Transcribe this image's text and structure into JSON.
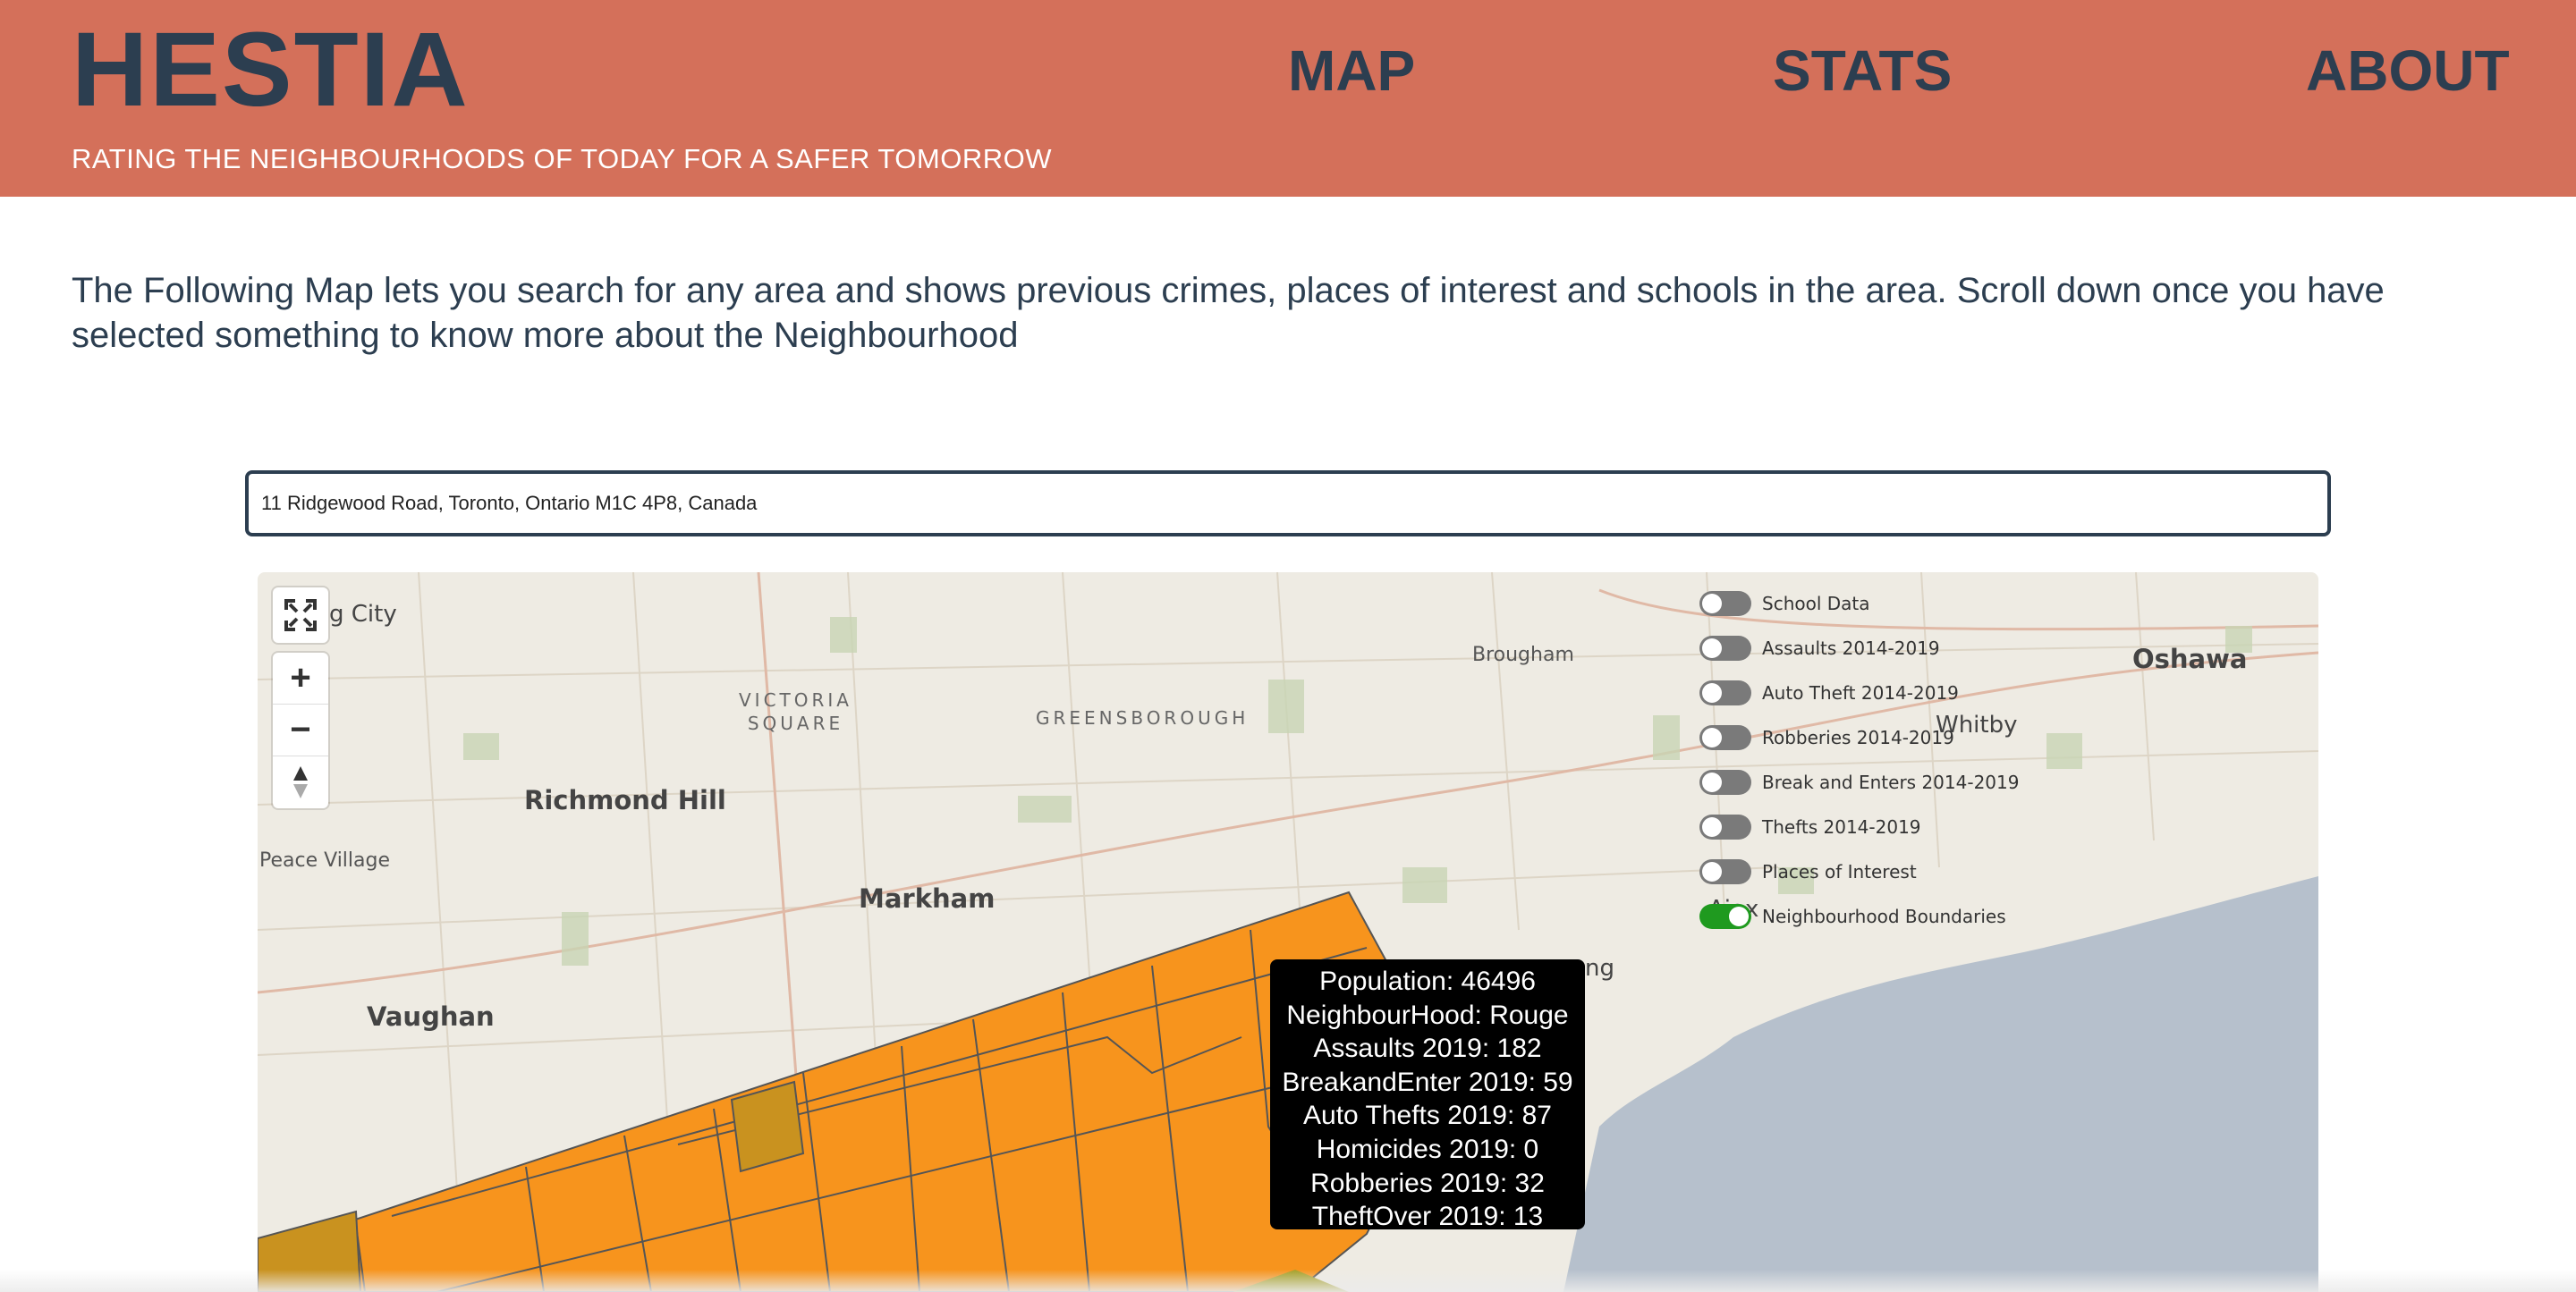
{
  "header": {
    "brand": "HESTIA",
    "tagline": "RATING THE NEIGHBOURHOODS OF TODAY FOR A SAFER TOMORROW",
    "nav": {
      "map": "MAP",
      "stats": "STATS",
      "about": "ABOUT"
    }
  },
  "intro": "The Following Map lets you search for any area and shows previous crimes, places of interest and schools in the area. Scroll down once you have selected something to know more about the Neighbourhood",
  "search": {
    "value": "11 Ridgewood Road, Toronto, Ontario M1C 4P8, Canada"
  },
  "map": {
    "controls": {
      "fullscreen": "fullscreen-icon",
      "zoom_in": "+",
      "zoom_out": "−",
      "compass": "compass-icon"
    },
    "labels": {
      "king_city": "g City",
      "victoria": "VICTORIA",
      "square": "SQUARE",
      "greensborough": "GREENSBOROUGH",
      "brougham": "Brougham",
      "oshawa": "Oshawa",
      "whitby": "Whitby",
      "richmond_hill": "Richmond Hill",
      "peace_village": "Peace Village",
      "markham": "Markham",
      "vaughan": "Vaughan",
      "ajax": "Ajax",
      "pickering": "ng"
    },
    "layers": [
      {
        "label": "School Data",
        "on": false
      },
      {
        "label": "Assaults 2014-2019",
        "on": false
      },
      {
        "label": "Auto Theft 2014-2019",
        "on": false
      },
      {
        "label": "Robberies 2014-2019",
        "on": false
      },
      {
        "label": "Break and Enters 2014-2019",
        "on": false
      },
      {
        "label": "Thefts 2014-2019",
        "on": false
      },
      {
        "label": "Places of Interest",
        "on": false
      },
      {
        "label": "Neighbourhood Boundaries",
        "on": true
      }
    ],
    "tooltip": {
      "population": "Population: 46496",
      "neighbourhood": "NeighbourHood: Rouge",
      "assaults": "Assaults 2019: 182",
      "break_enter": "BreakandEnter 2019: 59",
      "auto_thefts": "Auto Thefts 2019: 87",
      "homicides": "Homicides 2019: 0",
      "robberies": "Robberies 2019: 32",
      "theft_over": "TheftOver 2019: 13"
    },
    "colors": {
      "neighbourhood_fill": "#f7941d",
      "selected_fill": "#c9921f",
      "water": "#b6c0cc",
      "land": "#eeebe3"
    }
  }
}
